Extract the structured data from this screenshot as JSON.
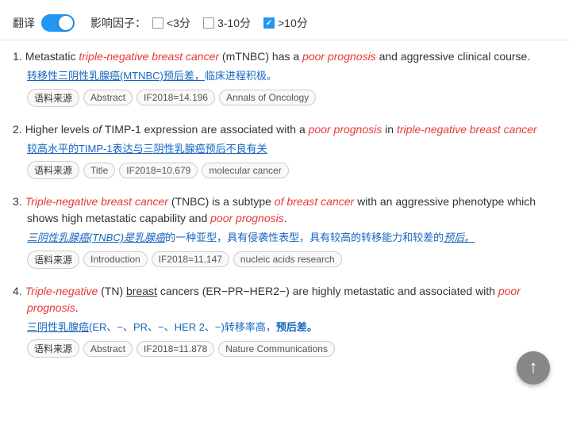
{
  "toolbar": {
    "translate_label": "翻译",
    "impact_label": "影响因子：",
    "filter_lt3_label": "<3分",
    "filter_3to10_label": "3-10分",
    "filter_gt10_label": ">10分",
    "filter_gt10_checked": true,
    "filter_lt3_checked": false,
    "filter_3to10_checked": false
  },
  "results": [
    {
      "number": "1.",
      "en_parts": [
        {
          "text": "Metastatic ",
          "style": "normal"
        },
        {
          "text": "triple-negative breast cancer",
          "style": "italic-red"
        },
        {
          "text": " (mTNBC) has a ",
          "style": "normal"
        },
        {
          "text": "poor prognosis",
          "style": "italic-red"
        },
        {
          "text": " and aggressive clinical course.",
          "style": "normal"
        }
      ],
      "zh": "转移性三阴性乳腺癌(MTNBC)预后差，临床进程积极。",
      "zh_underline": [
        "转移性三阴性乳腺癌(MTNBC)预后差"
      ],
      "tags": [
        "语料来源",
        "Abstract",
        "IF2018=14.196",
        "Annals of Oncology"
      ]
    },
    {
      "number": "2.",
      "en_parts": [
        {
          "text": "Higher levels ",
          "style": "normal"
        },
        {
          "text": "of",
          "style": "italic"
        },
        {
          "text": " TIMP-1 expression are associated with a ",
          "style": "normal"
        },
        {
          "text": "poor prognosis",
          "style": "italic-red"
        },
        {
          "text": " in ",
          "style": "normal"
        },
        {
          "text": "triple-negative breast cancer",
          "style": "italic-red"
        }
      ],
      "zh": "较高水平的TIMP-1表达与三阴性乳腺癌预后不良有关",
      "zh_underline": [
        "较高水平的TIMP-1表达与三阴性乳腺癌预后不良有关"
      ],
      "tags": [
        "语料来源",
        "Title",
        "IF2018=10.679",
        "molecular cancer"
      ]
    },
    {
      "number": "3.",
      "en_parts": [
        {
          "text": "Triple-negative breast cancer",
          "style": "italic-red"
        },
        {
          "text": " (TNBC) is a subtype ",
          "style": "normal"
        },
        {
          "text": "of breast cancer",
          "style": "italic-red"
        },
        {
          "text": " with an aggressive phenotype which shows high metastatic capability and ",
          "style": "normal"
        },
        {
          "text": "poor prognosis",
          "style": "italic-red"
        },
        {
          "text": ".",
          "style": "normal"
        }
      ],
      "zh": "三阴性乳腺癌(TNBC)是乳腺癌的一种亚型，具有侵袭性表型，具有较高的转移能力和较差的预后。",
      "zh_underline_italic": [
        "三阴性乳腺癌(TNBC)",
        "乳腺癌",
        "预后。"
      ],
      "tags": [
        "语料来源",
        "Introduction",
        "IF2018=11.147",
        "nucleic acids research"
      ]
    },
    {
      "number": "4.",
      "en_parts": [
        {
          "text": "Triple-negative",
          "style": "italic-red"
        },
        {
          "text": " (TN) ",
          "style": "normal"
        },
        {
          "text": "breast",
          "style": "underline"
        },
        {
          "text": " cancers (ER−PR−HER2−) are highly metastatic and associated with ",
          "style": "normal"
        },
        {
          "text": "poor prognosis",
          "style": "italic-red"
        },
        {
          "text": ".",
          "style": "normal"
        }
      ],
      "zh": "三阴性乳腺癌(ER、−、PR、−、HER 2、−)转移率高，预后差。",
      "zh_underline": [
        "三阴性乳腺癌(ER"
      ],
      "tags": [
        "语料来源",
        "Abstract",
        "IF2018=11.878",
        "Nature Communications"
      ]
    }
  ],
  "scroll_top_label": "↑"
}
